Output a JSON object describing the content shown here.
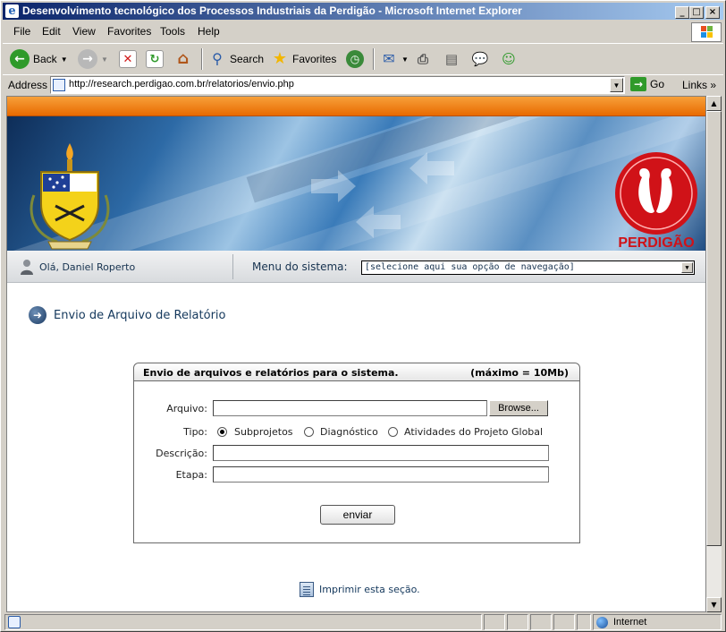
{
  "window": {
    "title": "Desenvolvimento tecnológico dos Processos Industriais da Perdigão - Microsoft Internet Explorer",
    "controls": [
      "minimize",
      "maximize",
      "close"
    ]
  },
  "menubar": {
    "items": [
      "File",
      "Edit",
      "View",
      "Favorites",
      "Tools",
      "Help"
    ]
  },
  "toolbar": {
    "back_label": "Back",
    "search_label": "Search",
    "favorites_label": "Favorites"
  },
  "addressbar": {
    "label": "Address",
    "url": "http://research.perdigao.com.br/relatorios/envio.php",
    "go_label": "Go",
    "links_label": "Links"
  },
  "banner": {
    "logo_text": "PERDIGÃO"
  },
  "nav": {
    "greeting": "Olá, Daniel Roperto",
    "menu_label": "Menu do sistema:",
    "menu_selected": "[selecione aqui sua opção de navegação]"
  },
  "page": {
    "section_title": "Envio de Arquivo de Relatório"
  },
  "form": {
    "header_title": "Envio de arquivos e relatórios para o sistema.",
    "header_limit": "(máximo = 10Mb)",
    "arquivo_label": "Arquivo:",
    "browse_label": "Browse...",
    "tipo_label": "Tipo:",
    "tipo_options": [
      "Subprojetos",
      "Diagnóstico",
      "Atividades do Projeto Global"
    ],
    "tipo_selected": "Subprojetos",
    "descricao_label": "Descrição:",
    "etapa_label": "Etapa:",
    "submit_label": "enviar"
  },
  "print_link": "Imprimir esta seção.",
  "statusbar": {
    "zone": "Internet"
  },
  "colors": {
    "orange_bar": "#e86a00",
    "banner_blue": "#2d6aa6",
    "perdigao_red": "#d01218",
    "title_bar": "#0a246a"
  }
}
